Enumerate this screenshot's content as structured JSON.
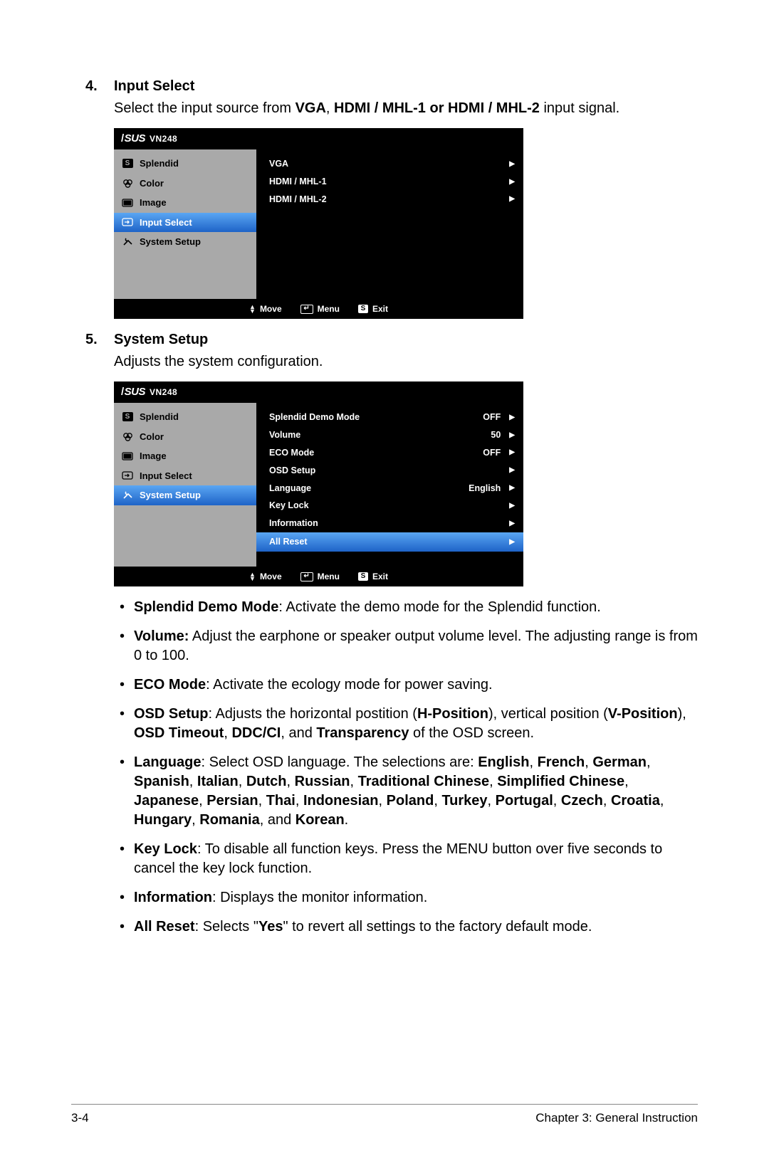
{
  "section4": {
    "num": "4.",
    "title": "Input Select",
    "body_pre": "Select the input source from ",
    "body_bold": "VGA",
    "body_mid": ", ",
    "body_bold2": "HDMI / MHL-1 or HDMI / MHL-2",
    "body_post": " input signal."
  },
  "section5": {
    "num": "5.",
    "title": "System Setup",
    "body": "Adjusts the system configuration."
  },
  "osd_common": {
    "brand": "SUS",
    "model": "VN248",
    "menu": {
      "splendid": "Splendid",
      "color": "Color",
      "image": "Image",
      "input_select": "Input Select",
      "system_setup": "System Setup"
    },
    "footer": {
      "move": "Move",
      "menu": "Menu",
      "exit": "Exit",
      "s": "S"
    }
  },
  "osd1": {
    "opts": {
      "vga": "VGA",
      "hdmi1": "HDMI / MHL-1",
      "hdmi2": "HDMI / MHL-2"
    }
  },
  "osd2": {
    "opts": {
      "splendid_demo": {
        "label": "Splendid Demo Mode",
        "val": "OFF"
      },
      "volume": {
        "label": "Volume",
        "val": "50"
      },
      "eco": {
        "label": "ECO Mode",
        "val": "OFF"
      },
      "osd_setup": {
        "label": "OSD Setup",
        "val": ""
      },
      "language": {
        "label": "Language",
        "val": "English"
      },
      "keylock": {
        "label": "Key Lock",
        "val": ""
      },
      "info": {
        "label": "Information",
        "val": ""
      },
      "all_reset": {
        "label": "All Reset",
        "val": ""
      }
    }
  },
  "bullets": {
    "b1_t1": "Splendid Demo Mode",
    "b1_t2": ": Activate the demo mode for the Splendid function.",
    "b2_t1": "Volume:",
    "b2_t2": " Adjust the earphone or speaker output volume level. The adjusting range is from 0 to 100.",
    "b3_t1": "ECO Mode",
    "b3_t2": ": Activate the ecology mode for power saving.",
    "b4_t1": "OSD Setup",
    "b4_t2": ": Adjusts the horizontal postition (",
    "b4_t3": "H-Position",
    "b4_t4": "), vertical position (",
    "b4_t5": "V-Position",
    "b4_t6": "), ",
    "b4_t7": "OSD Timeout",
    "b4_t8": ", ",
    "b4_t9": "DDC/CI",
    "b4_t10": ", and ",
    "b4_t11": "Transparency",
    "b4_t12": " of the OSD screen.",
    "b5_t1": "Language",
    "b5_t2": ": Select OSD language. The selections are: ",
    "b5_l1": "English",
    "b5_c": ", ",
    "b5_l2": "French",
    "b5_l3": "German",
    "b5_l4": "Spanish",
    "b5_l5": "Italian",
    "b5_l6": "Dutch",
    "b5_l7": "Russian",
    "b5_l8": "Traditional Chinese",
    "b5_l9": "Simplified Chinese",
    "b5_l10": "Japanese",
    "b5_l11": "Persian",
    "b5_l12": "Thai",
    "b5_l13": "Indonesian",
    "b5_l14": "Poland",
    "b5_l15": "Turkey",
    "b5_l16": "Portugal",
    "b5_l17": "Czech",
    "b5_l18": "Croatia",
    "b5_l19": "Hungary",
    "b5_l20": "Romania",
    "b5_and": ", and ",
    "b5_l21": "Korean",
    "b5_end": ".",
    "b6_t1": "Key Lock",
    "b6_t2": ": To disable all function keys. Press the MENU button over five seconds to cancel the key lock function.",
    "b7_t1": "Information",
    "b7_t2": ": Displays the monitor information.",
    "b8_t1": "All Reset",
    "b8_t2": ": Selects \"",
    "b8_t3": "Yes",
    "b8_t4": "\" to revert all settings to the factory default mode."
  },
  "footer": {
    "pageno": "3-4",
    "chapter": "Chapter 3: General Instruction"
  }
}
